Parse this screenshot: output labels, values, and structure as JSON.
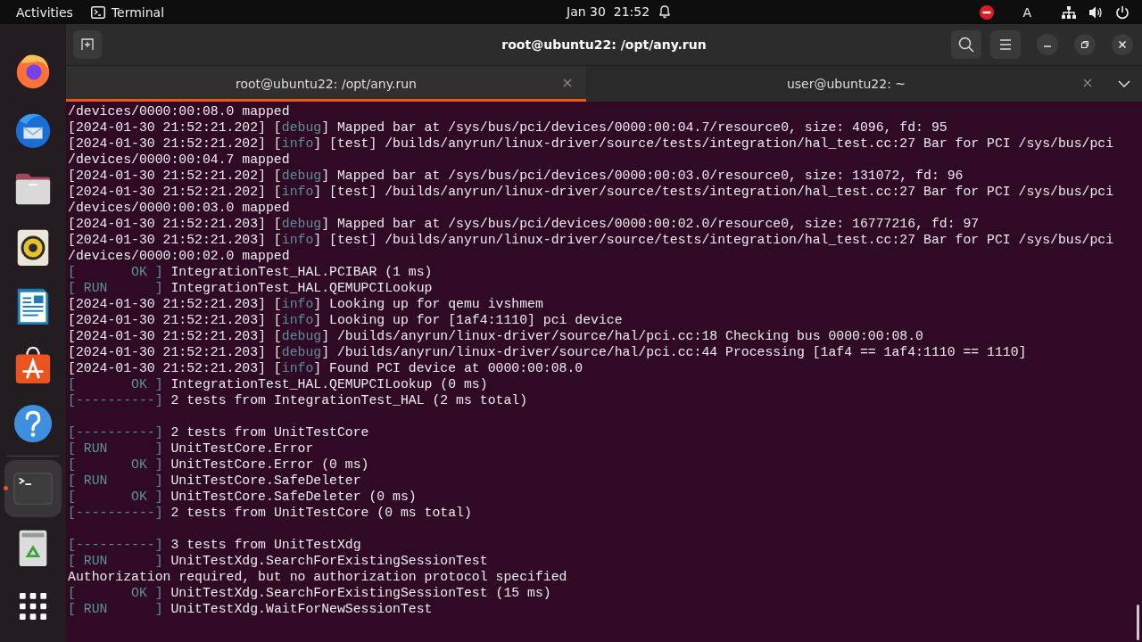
{
  "top_bar": {
    "activities": "Activities",
    "app_name": "Terminal",
    "clock": "Jan 30  21:52",
    "input_source": "A"
  },
  "dock": {
    "items": [
      {
        "kind": "firefox",
        "selected": false,
        "running": false
      },
      {
        "kind": "thunderbird",
        "selected": false,
        "running": false
      },
      {
        "kind": "files",
        "selected": false,
        "running": false
      },
      {
        "kind": "rhythmbox",
        "selected": false,
        "running": false
      },
      {
        "kind": "writer",
        "selected": false,
        "running": false
      },
      {
        "kind": "appcenter",
        "selected": false,
        "running": false
      },
      {
        "kind": "help",
        "selected": false,
        "running": false
      },
      {
        "kind": "terminal",
        "selected": true,
        "running": true
      },
      {
        "kind": "trash",
        "selected": false,
        "running": false
      },
      {
        "kind": "apps",
        "selected": false,
        "running": false
      }
    ]
  },
  "window": {
    "title": "root@ubuntu22: /opt/any.run",
    "tabs": [
      {
        "label": "root@ubuntu22: /opt/any.run",
        "selected": true
      },
      {
        "label": "user@ubuntu22: ~",
        "selected": false
      }
    ],
    "terminal": {
      "lines": [
        {
          "kind": "text",
          "segments": [
            {
              "text": "/devices/0000:00:08.0 mapped",
              "kind": "plain"
            }
          ]
        },
        {
          "kind": "text",
          "segments": [
            {
              "text": "[2024-01-30 21:52:21.202] [",
              "kind": "plain"
            },
            {
              "text": "debug",
              "kind": "tag"
            },
            {
              "text": "] Mapped bar at /sys/bus/pci/devices/0000:00:04.7/resource0, size: 4096, fd: 95",
              "kind": "plain"
            }
          ]
        },
        {
          "kind": "text",
          "segments": [
            {
              "text": "[2024-01-30 21:52:21.202] [",
              "kind": "plain"
            },
            {
              "text": "info",
              "kind": "tag"
            },
            {
              "text": "] [test] /builds/anyrun/linux-driver/source/tests/integration/hal_test.cc:27 Bar for PCI /sys/bus/pci",
              "kind": "plain"
            }
          ]
        },
        {
          "kind": "text",
          "segments": [
            {
              "text": "/devices/0000:00:04.7 mapped",
              "kind": "plain"
            }
          ]
        },
        {
          "kind": "text",
          "segments": [
            {
              "text": "[2024-01-30 21:52:21.202] [",
              "kind": "plain"
            },
            {
              "text": "debug",
              "kind": "tag"
            },
            {
              "text": "] Mapped bar at /sys/bus/pci/devices/0000:00:03.0/resource0, size: 131072, fd: 96",
              "kind": "plain"
            }
          ]
        },
        {
          "kind": "text",
          "segments": [
            {
              "text": "[2024-01-30 21:52:21.202] [",
              "kind": "plain"
            },
            {
              "text": "info",
              "kind": "tag"
            },
            {
              "text": "] [test] /builds/anyrun/linux-driver/source/tests/integration/hal_test.cc:27 Bar for PCI /sys/bus/pci",
              "kind": "plain"
            }
          ]
        },
        {
          "kind": "text",
          "segments": [
            {
              "text": "/devices/0000:00:03.0 mapped",
              "kind": "plain"
            }
          ]
        },
        {
          "kind": "text",
          "segments": [
            {
              "text": "[2024-01-30 21:52:21.203] [",
              "kind": "plain"
            },
            {
              "text": "debug",
              "kind": "tag"
            },
            {
              "text": "] Mapped bar at /sys/bus/pci/devices/0000:00:02.0/resource0, size: 16777216, fd: 97",
              "kind": "plain"
            }
          ]
        },
        {
          "kind": "text",
          "segments": [
            {
              "text": "[2024-01-30 21:52:21.203] [",
              "kind": "plain"
            },
            {
              "text": "info",
              "kind": "tag"
            },
            {
              "text": "] [test] /builds/anyrun/linux-driver/source/tests/integration/hal_test.cc:27 Bar for PCI /sys/bus/pci",
              "kind": "plain"
            }
          ]
        },
        {
          "kind": "text",
          "segments": [
            {
              "text": "/devices/0000:00:02.0 mapped",
              "kind": "plain"
            }
          ]
        },
        {
          "kind": "text",
          "segments": [
            {
              "text": "[       OK ]",
              "kind": "tag"
            },
            {
              "text": " IntegrationTest_HAL.PCIBAR (1 ms)",
              "kind": "plain"
            }
          ]
        },
        {
          "kind": "text",
          "segments": [
            {
              "text": "[ RUN      ]",
              "kind": "tag"
            },
            {
              "text": " IntegrationTest_HAL.QEMUPCILookup",
              "kind": "plain"
            }
          ]
        },
        {
          "kind": "text",
          "segments": [
            {
              "text": "[2024-01-30 21:52:21.203] [",
              "kind": "plain"
            },
            {
              "text": "info",
              "kind": "tag"
            },
            {
              "text": "] Looking up for qemu ivshmem",
              "kind": "plain"
            }
          ]
        },
        {
          "kind": "text",
          "segments": [
            {
              "text": "[2024-01-30 21:52:21.203] [",
              "kind": "plain"
            },
            {
              "text": "info",
              "kind": "tag"
            },
            {
              "text": "] Looking up for [1af4:1110] pci device",
              "kind": "plain"
            }
          ]
        },
        {
          "kind": "text",
          "segments": [
            {
              "text": "[2024-01-30 21:52:21.203] [",
              "kind": "plain"
            },
            {
              "text": "debug",
              "kind": "tag"
            },
            {
              "text": "] /builds/anyrun/linux-driver/source/hal/pci.cc:18 Checking bus 0000:00:08.0",
              "kind": "plain"
            }
          ]
        },
        {
          "kind": "text",
          "segments": [
            {
              "text": "[2024-01-30 21:52:21.203] [",
              "kind": "plain"
            },
            {
              "text": "debug",
              "kind": "tag"
            },
            {
              "text": "] /builds/anyrun/linux-driver/source/hal/pci.cc:44 Processing [1af4 == 1af4:1110 == 1110]",
              "kind": "plain"
            }
          ]
        },
        {
          "kind": "text",
          "segments": [
            {
              "text": "[2024-01-30 21:52:21.203] [",
              "kind": "plain"
            },
            {
              "text": "info",
              "kind": "tag"
            },
            {
              "text": "] Found PCI device at 0000:00:08.0",
              "kind": "plain"
            }
          ]
        },
        {
          "kind": "text",
          "segments": [
            {
              "text": "[       OK ]",
              "kind": "tag"
            },
            {
              "text": " IntegrationTest_HAL.QEMUPCILookup (0 ms)",
              "kind": "plain"
            }
          ]
        },
        {
          "kind": "text",
          "segments": [
            {
              "text": "[----------]",
              "kind": "tag"
            },
            {
              "text": " 2 tests from IntegrationTest_HAL (2 ms total)",
              "kind": "plain"
            }
          ]
        },
        {
          "kind": "blank"
        },
        {
          "kind": "text",
          "segments": [
            {
              "text": "[----------]",
              "kind": "tag"
            },
            {
              "text": " 2 tests from UnitTestCore",
              "kind": "plain"
            }
          ]
        },
        {
          "kind": "text",
          "segments": [
            {
              "text": "[ RUN      ]",
              "kind": "tag"
            },
            {
              "text": " UnitTestCore.Error",
              "kind": "plain"
            }
          ]
        },
        {
          "kind": "text",
          "segments": [
            {
              "text": "[       OK ]",
              "kind": "tag"
            },
            {
              "text": " UnitTestCore.Error (0 ms)",
              "kind": "plain"
            }
          ]
        },
        {
          "kind": "text",
          "segments": [
            {
              "text": "[ RUN      ]",
              "kind": "tag"
            },
            {
              "text": " UnitTestCore.SafeDeleter",
              "kind": "plain"
            }
          ]
        },
        {
          "kind": "text",
          "segments": [
            {
              "text": "[       OK ]",
              "kind": "tag"
            },
            {
              "text": " UnitTestCore.SafeDeleter (0 ms)",
              "kind": "plain"
            }
          ]
        },
        {
          "kind": "text",
          "segments": [
            {
              "text": "[----------]",
              "kind": "tag"
            },
            {
              "text": " 2 tests from UnitTestCore (0 ms total)",
              "kind": "plain"
            }
          ]
        },
        {
          "kind": "blank"
        },
        {
          "kind": "text",
          "segments": [
            {
              "text": "[----------]",
              "kind": "tag"
            },
            {
              "text": " 3 tests from UnitTestXdg",
              "kind": "plain"
            }
          ]
        },
        {
          "kind": "text",
          "segments": [
            {
              "text": "[ RUN      ]",
              "kind": "tag"
            },
            {
              "text": " UnitTestXdg.SearchForExistingSessionTest",
              "kind": "plain"
            }
          ]
        },
        {
          "kind": "text",
          "segments": [
            {
              "text": "Authorization required, but no authorization protocol specified",
              "kind": "plain"
            }
          ]
        },
        {
          "kind": "text",
          "segments": [
            {
              "text": "[       OK ]",
              "kind": "tag"
            },
            {
              "text": " UnitTestXdg.SearchForExistingSessionTest (15 ms)",
              "kind": "plain"
            }
          ]
        },
        {
          "kind": "text",
          "segments": [
            {
              "text": "[ RUN      ]",
              "kind": "tag"
            },
            {
              "text": " UnitTestXdg.WaitForNewSessionTest",
              "kind": "plain"
            }
          ]
        }
      ]
    }
  }
}
